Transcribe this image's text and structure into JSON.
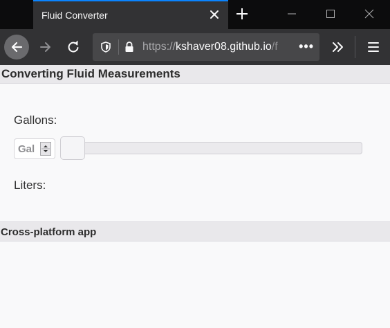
{
  "browser": {
    "tab_title": "Fluid Converter",
    "url": {
      "scheme": "https://",
      "host": "kshaver08.github.io",
      "rest": "/f"
    },
    "page_actions_label": "•••",
    "icons": {
      "tab_close": "close-icon",
      "new_tab": "plus-icon",
      "back": "arrow-left-icon",
      "forward": "arrow-right-icon",
      "reload": "reload-icon",
      "tracking_protection": "shield-icon",
      "secure": "lock-icon",
      "overflow": "chevron-double-right-icon",
      "menu": "hamburger-icon"
    },
    "colors": {
      "tab_accent": "#0a84ff",
      "chrome_dark": "#0c0c0d",
      "chrome": "#323234",
      "urlbar": "#474749"
    }
  },
  "page": {
    "title": "Converting Fluid Measurements",
    "gallons_label": "Gallons:",
    "gallons_placeholder": "Gal",
    "slider_value": 0.0,
    "liters_label": "Liters:",
    "footer": "Cross-platform app"
  }
}
